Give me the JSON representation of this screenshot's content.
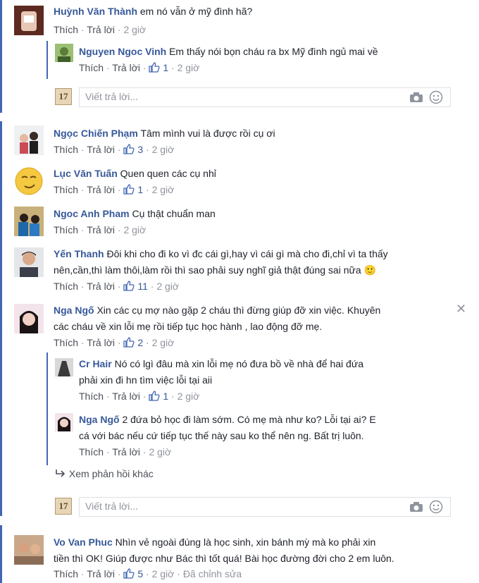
{
  "icons": {
    "like": "thumbs-up-icon",
    "camera": "camera-icon",
    "emoji": "smiley-icon",
    "close": "close-icon",
    "more": "reply-arrow-icon"
  },
  "colors": {
    "name": "#365899",
    "meta": "#90949c",
    "accent_bar": "#4267b2"
  },
  "labels": {
    "like": "Thích",
    "reply": "Trả lời",
    "sep": "·",
    "edit": "Đã chỉnh sửa",
    "reply_placeholder": "Viết trả lời...",
    "more_replies": "Xem phản hồi khác",
    "reply_avatar_text": "17"
  },
  "comments": [
    {
      "name": "Huỳnh Văn Thành",
      "text": "em nó vẫn ở mỹ đình hã?",
      "likes": "",
      "time": "2 giờ"
    },
    {
      "name": "Nguyen Ngoc Vinh",
      "text": "Em thấy nói bọn cháu ra bx Mỹ đình ngủ mai về",
      "likes": "1",
      "time": "2 giờ"
    },
    {
      "name": "Ngọc Chiến Phạm",
      "text": "Tâm mình vui là được rồi cụ ơi",
      "likes": "3",
      "time": "2 giờ"
    },
    {
      "name": "Lục Văn Tuấn",
      "text": "Quen quen các cụ nhỉ",
      "likes": "1",
      "time": "2 giờ"
    },
    {
      "name": "Ngoc Anh Pham",
      "text": "Cụ thật chuẩn man",
      "likes": "",
      "time": "2 giờ"
    },
    {
      "name": "Yến Thanh",
      "text": "Đôi khi cho đi ko vì đc cái gì,hay vì cái gì mà cho đi,chỉ vì ta thấy",
      "text2": "nên,cần,thì làm thôi,làm rồi thì sao phải suy nghĩ giả thật đúng sai nữa 🙂",
      "likes": "11",
      "time": "2 giờ"
    },
    {
      "name": "Nga Ngố",
      "text": "Xin các cụ mợ nào gặp 2 cháu thì đừng giúp đỡ xin việc. Khuyên",
      "text2": "các cháu về xin lỗi mẹ rồi tiếp tục học hành , lao động đỡ mẹ.",
      "likes": "2",
      "time": "2 giờ"
    },
    {
      "name": "Cr Hair",
      "text": "Nó có lgì đâu mà xin lỗi mẹ nó đưa bồ về nhà để hai đứa",
      "text2": "phải xin đi hn tìm việc lỗi tại aii",
      "likes": "1",
      "time": "2 giờ"
    },
    {
      "name": "Nga Ngố",
      "text": "2 đứa bỏ học đi làm sớm. Có mẹ mà như ko? Lỗi tại ai? E",
      "text2": "cá với bác nếu cứ tiếp tục thế này sau ko thể nên ng. Bất trị luôn.",
      "likes": "",
      "time": "2 giờ"
    },
    {
      "name": "Vo Van Phuc",
      "text": "Nhìn vẻ ngoài đúng là học sinh, xin bánh mỳ mà ko phải xin",
      "text2": "tiền thì OK! Giúp được như Bác thì tốt quá! Bài học đường đời cho 2 em luôn.",
      "likes": "5",
      "time": "2 giờ"
    }
  ]
}
